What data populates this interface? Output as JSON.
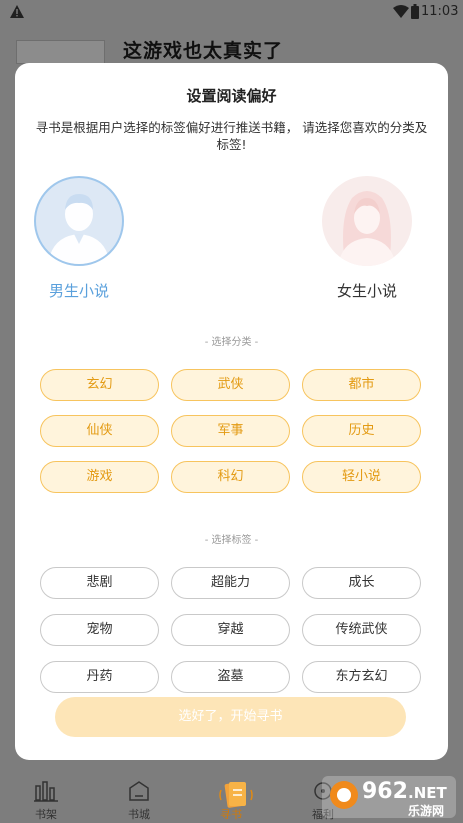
{
  "status_bar": {
    "time": "11:03"
  },
  "background": {
    "title": "这游戏也太真实了"
  },
  "modal": {
    "title": "设置阅读偏好",
    "description": "寻书是根据用户选择的标签偏好进行推送书籍， 请选择您喜欢的分类及标签!",
    "genders": {
      "male": "男生小说",
      "female": "女生小说"
    },
    "category_section_label": "- 选择分类 -",
    "categories": [
      "玄幻",
      "武侠",
      "都市",
      "仙侠",
      "军事",
      "历史",
      "游戏",
      "科幻",
      "轻小说"
    ],
    "tag_section_label": "- 选择标签 -",
    "tags": [
      "悲剧",
      "超能力",
      "成长",
      "宠物",
      "穿越",
      "传统武侠",
      "丹药",
      "盗墓",
      "东方玄幻"
    ],
    "start_button": "选好了，开始寻书"
  },
  "bottom_nav": {
    "items": [
      {
        "label": "书架",
        "icon": "bookshelf-icon"
      },
      {
        "label": "书城",
        "icon": "bookstore-icon"
      },
      {
        "label": "寻书",
        "icon": "find-book-icon"
      },
      {
        "label": "福利",
        "icon": "welfare-icon"
      }
    ]
  },
  "watermark": {
    "text": "962.NET",
    "subtext": "乐游网"
  },
  "colors": {
    "category_chip": "#f7c45e",
    "male_accent": "#5aa0dc",
    "button": "#fde5b7"
  }
}
